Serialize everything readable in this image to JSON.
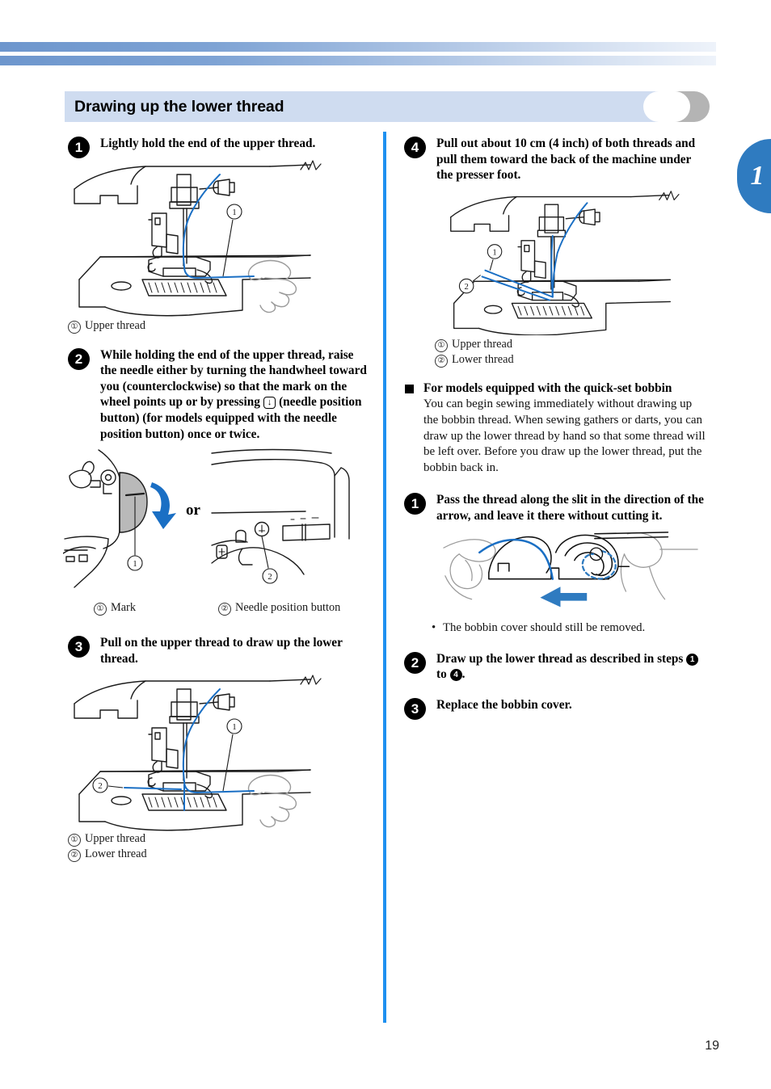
{
  "page": {
    "number": "19",
    "chapter_tab": "1",
    "heading": "Drawing up the lower thread"
  },
  "left_column": {
    "steps": [
      {
        "badge": "1",
        "text": "Lightly hold the end of the upper thread.",
        "captions": [
          {
            "num": "①",
            "label": "Upper thread"
          }
        ]
      },
      {
        "badge": "2",
        "text_part1": "While holding the end of the upper thread, raise the needle either by turning the handwheel toward you (counterclockwise) so that the mark on the wheel points up or by pressing ",
        "button_icon": "↓",
        "text_part2": " (needle position button) (for models equipped with the needle position button) once or twice.",
        "or_label": "or",
        "captions": [
          {
            "num": "①",
            "label": "Mark"
          },
          {
            "num": "②",
            "label": "Needle position button"
          }
        ]
      },
      {
        "badge": "3",
        "text": "Pull on the upper thread to draw up the lower thread.",
        "captions": [
          {
            "num": "①",
            "label": "Upper thread"
          },
          {
            "num": "②",
            "label": "Lower thread"
          }
        ]
      }
    ]
  },
  "right_column": {
    "steps": [
      {
        "badge": "4",
        "text": "Pull out about 10 cm (4 inch) of both threads and pull them toward the back of the machine under the presser foot.",
        "captions": [
          {
            "num": "①",
            "label": "Upper thread"
          },
          {
            "num": "②",
            "label": "Lower thread"
          }
        ]
      }
    ],
    "subsection": {
      "heading": "For models equipped with the quick-set bobbin",
      "paragraph": "You can begin sewing immediately without drawing up the bobbin thread. When sewing gathers or darts, you can draw up the lower thread by hand so that some thread will be left over. Before you draw up the lower thread, put the bobbin back in.",
      "steps": [
        {
          "badge": "1",
          "text": "Pass the thread along the slit in the direction of the arrow, and leave it there without cutting it.",
          "note_bullet": "•",
          "note": "The bobbin cover should still be removed."
        },
        {
          "badge": "2",
          "text_part1": "Draw up the lower thread as described in steps ",
          "inline_badge_1": "1",
          "text_part2": " to ",
          "inline_badge_2": "4",
          "text_part3": "."
        },
        {
          "badge": "3",
          "text": "Replace the bobbin cover."
        }
      ]
    }
  },
  "colors": {
    "accent_blue": "#1e90f0",
    "tab_blue": "#2f7bc0",
    "band_blue": "#cfdcf0",
    "band_gray": "#b4b4b4",
    "thread_blue": "#1a6fc4"
  }
}
